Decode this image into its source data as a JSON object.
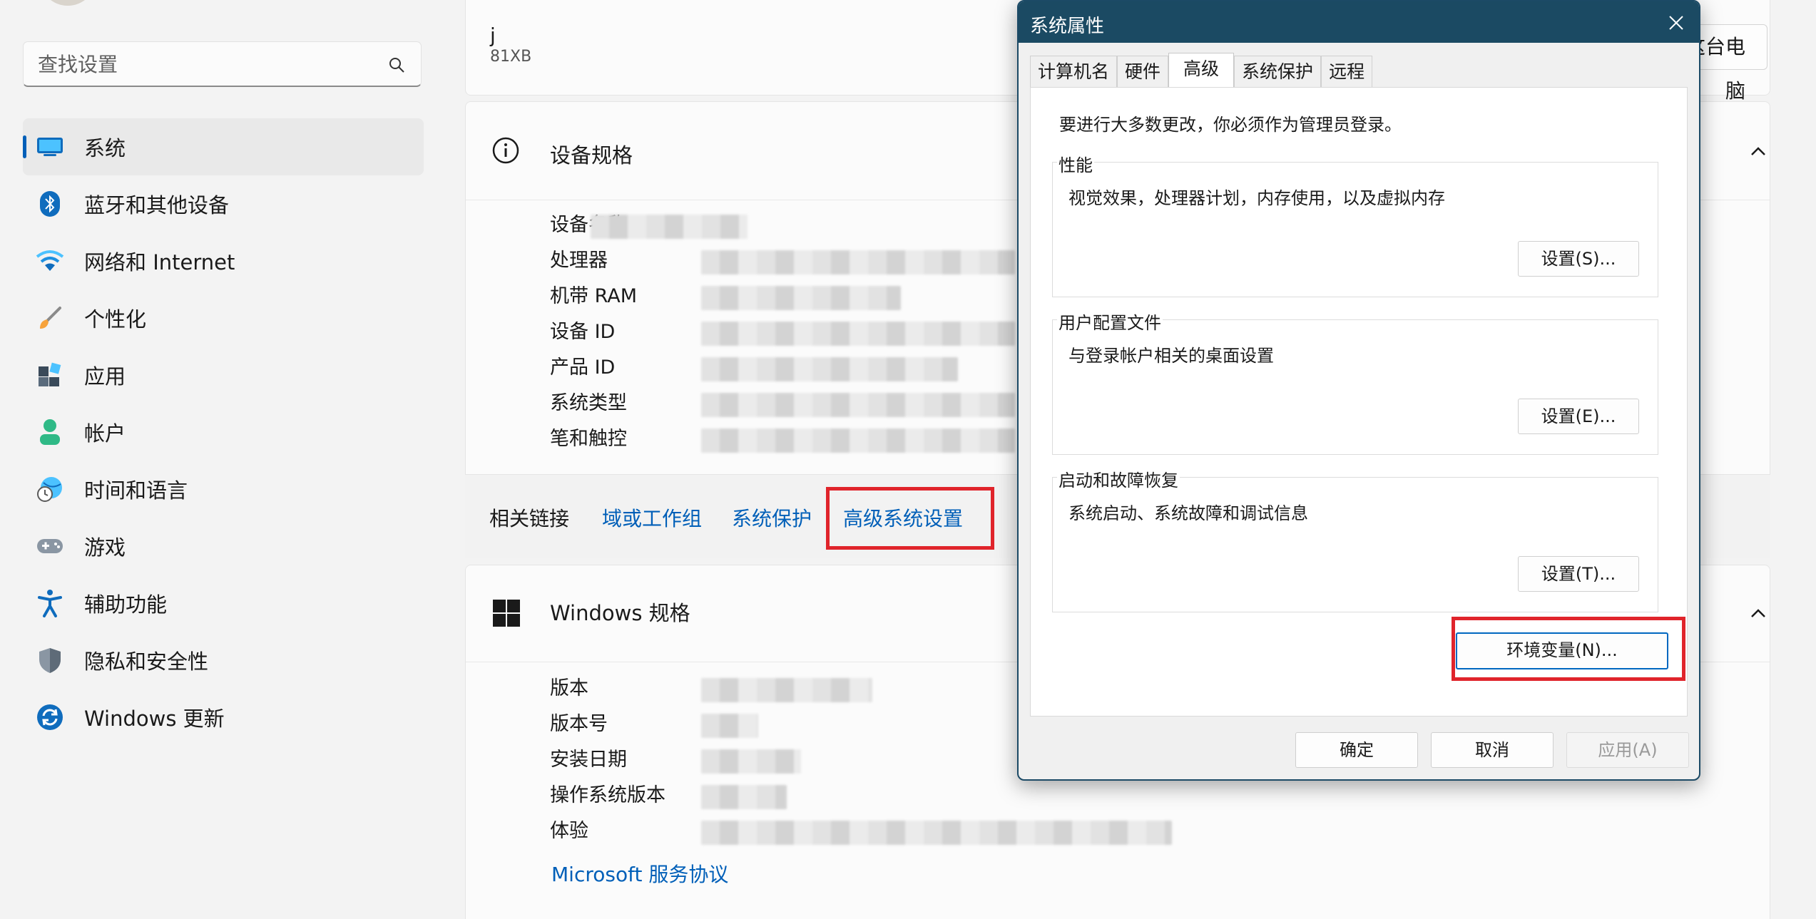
{
  "settings": {
    "search": {
      "placeholder": "查找设置"
    },
    "nav": [
      {
        "label": "系统",
        "icon": "monitor-icon",
        "active": true
      },
      {
        "label": "蓝牙和其他设备",
        "icon": "bluetooth-icon"
      },
      {
        "label": "网络和 Internet",
        "icon": "wifi-icon"
      },
      {
        "label": "个性化",
        "icon": "paintbrush-icon"
      },
      {
        "label": "应用",
        "icon": "apps-icon"
      },
      {
        "label": "帐户",
        "icon": "person-icon"
      },
      {
        "label": "时间和语言",
        "icon": "globe-clock-icon"
      },
      {
        "label": "游戏",
        "icon": "gamepad-icon"
      },
      {
        "label": "辅助功能",
        "icon": "accessibility-icon"
      },
      {
        "label": "隐私和安全性",
        "icon": "shield-icon"
      },
      {
        "label": "Windows 更新",
        "icon": "refresh-icon"
      }
    ]
  },
  "device": {
    "name": "j",
    "model": "81XB",
    "rename_button": "这台电脑"
  },
  "specs": {
    "title": "设备规格",
    "rows": [
      "设备名称",
      "处理器",
      "机带 RAM",
      "设备 ID",
      "产品 ID",
      "系统类型",
      "笔和触控"
    ]
  },
  "related": {
    "label": "相关链接",
    "links": [
      "域或工作组",
      "系统保护",
      "高级系统设置"
    ]
  },
  "windows_specs": {
    "title": "Windows 规格",
    "rows": [
      "版本",
      "版本号",
      "安装日期",
      "操作系统版本",
      "体验"
    ],
    "ms_link": "Microsoft 服务协议"
  },
  "dialog": {
    "title": "系统属性",
    "tabs": [
      "计算机名",
      "硬件",
      "高级",
      "系统保护",
      "远程"
    ],
    "active_tab": "高级",
    "admin_note": "要进行大多数更改，你必须作为管理员登录。",
    "groups": [
      {
        "title": "性能",
        "desc": "视觉效果，处理器计划，内存使用，以及虚拟内存",
        "button": "设置(S)..."
      },
      {
        "title": "用户配置文件",
        "desc": "与登录帐户相关的桌面设置",
        "button": "设置(E)..."
      },
      {
        "title": "启动和故障恢复",
        "desc": "系统启动、系统故障和调试信息",
        "button": "设置(T)..."
      }
    ],
    "env_button": "环境变量(N)...",
    "footer": {
      "ok": "确定",
      "cancel": "取消",
      "apply": "应用(A)"
    }
  },
  "colors": {
    "accent": "#005fb8",
    "highlight": "#e0242b",
    "dialog_titlebar": "#1b4a63"
  }
}
